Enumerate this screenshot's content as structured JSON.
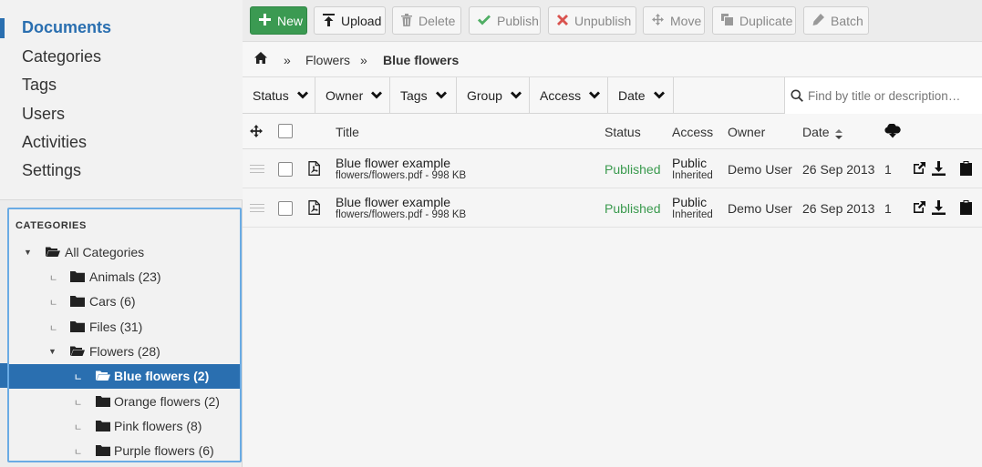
{
  "main_nav": {
    "items": [
      {
        "label": "Documents",
        "active": true
      },
      {
        "label": "Categories"
      },
      {
        "label": "Tags"
      },
      {
        "label": "Users"
      },
      {
        "label": "Activities"
      },
      {
        "label": "Settings"
      }
    ]
  },
  "categories": {
    "heading": "CATEGORIES",
    "tree": [
      {
        "label": "All Categories",
        "expanded": true
      },
      {
        "label": "Animals (23)"
      },
      {
        "label": "Cars (6)"
      },
      {
        "label": "Files (31)"
      },
      {
        "label": "Flowers (28)",
        "expanded": true
      },
      {
        "label": "Blue flowers (2)",
        "selected": true
      },
      {
        "label": "Orange flowers (2)"
      },
      {
        "label": "Pink flowers (8)"
      },
      {
        "label": "Purple flowers (6)"
      }
    ]
  },
  "toolbar": {
    "new": "New",
    "upload": "Upload",
    "delete": "Delete",
    "publish": "Publish",
    "unpublish": "Unpublish",
    "move": "Move",
    "duplicate": "Duplicate",
    "batch": "Batch"
  },
  "breadcrumb": {
    "separator": "»",
    "items": [
      "Flowers",
      "Blue flowers"
    ]
  },
  "filters": [
    "Status",
    "Owner",
    "Tags",
    "Group",
    "Access",
    "Date"
  ],
  "search": {
    "placeholder": "Find by title or description…",
    "value": ""
  },
  "table": {
    "columns": {
      "title": "Title",
      "status": "Status",
      "access": "Access",
      "owner": "Owner",
      "date": "Date"
    },
    "rows": [
      {
        "title": "Blue flower example",
        "file": "flowers/flowers.pdf - 998 KB",
        "status": "Published",
        "access": "Public",
        "access_sub": "Inherited",
        "owner": "Demo User",
        "date": "26 Sep 2013",
        "downloads": "1"
      },
      {
        "title": "Blue flower example",
        "file": "flowers/flowers.pdf - 998 KB",
        "status": "Published",
        "access": "Public",
        "access_sub": "Inherited",
        "owner": "Demo User",
        "date": "26 Sep 2013",
        "downloads": "1"
      }
    ]
  },
  "colors": {
    "accent": "#2a6fb0",
    "new_button": "#3b9a52",
    "published": "#3a9a4e",
    "tree_border": "#6aabe4"
  }
}
